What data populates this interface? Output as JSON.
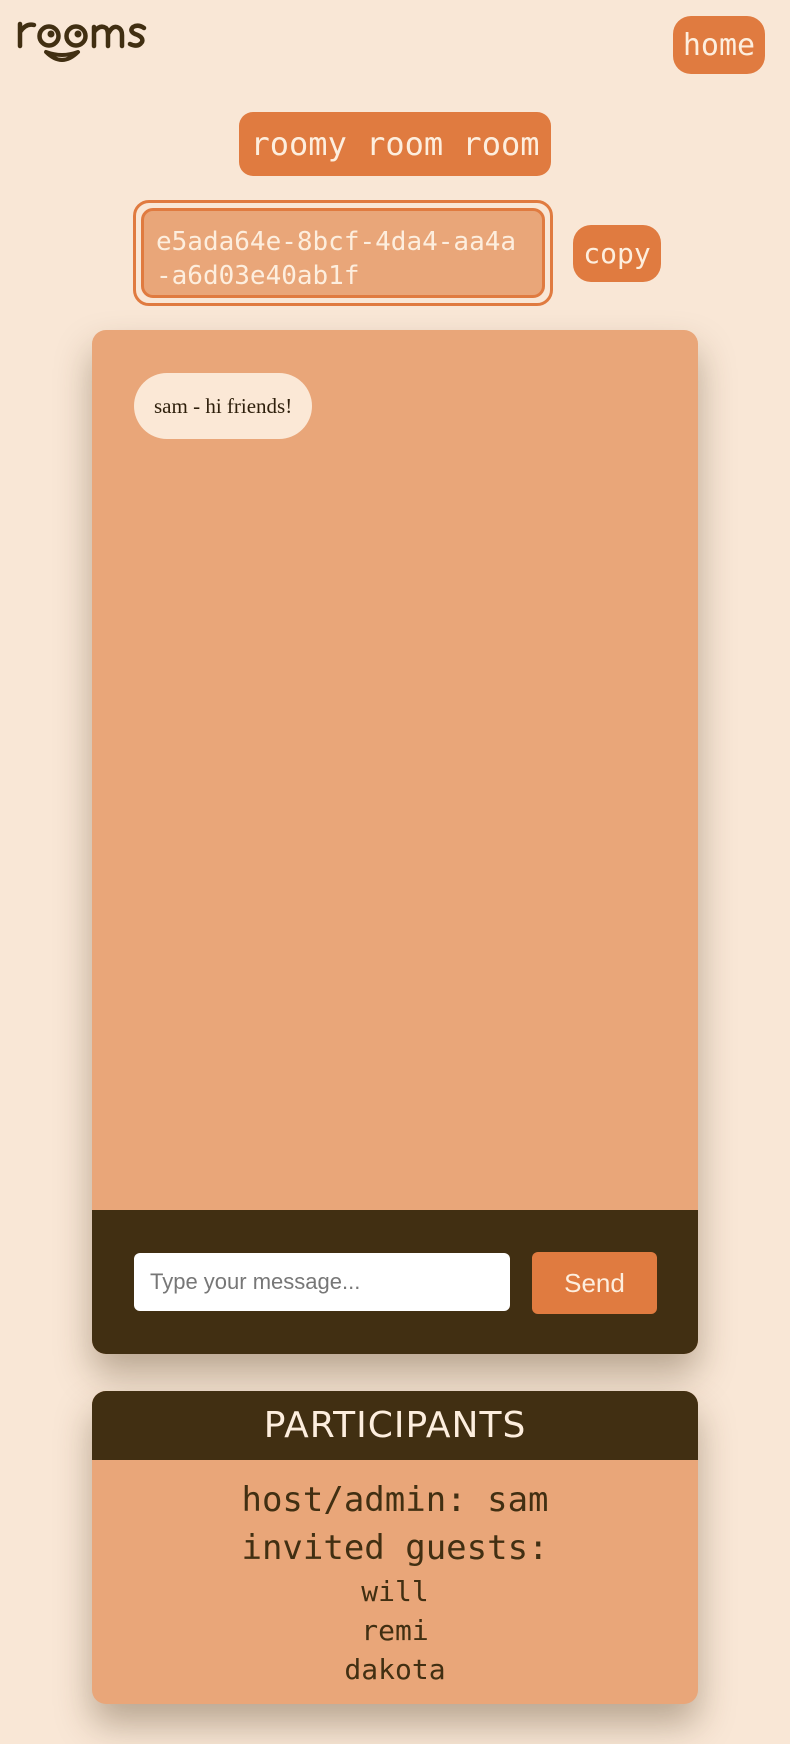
{
  "header": {
    "logo_text": "rooms",
    "home_label": "home"
  },
  "room": {
    "title": "roomy room room",
    "code": "e5ada64e-8bcf-4da4-aa4a-a6d03e40ab1f",
    "copy_label": "copy"
  },
  "chat": {
    "messages": [
      {
        "text": "sam - hi friends!"
      }
    ],
    "input_placeholder": "Type your message...",
    "send_label": "Send"
  },
  "participants": {
    "heading": "PARTICIPANTS",
    "host_line": "host/admin: sam",
    "guests_label": "invited guests:",
    "guests": [
      "will",
      "remi",
      "dakota"
    ]
  },
  "colors": {
    "background": "#f9e7d6",
    "accent": "#e07b40",
    "panel": "#e9a679",
    "dark": "#412f12",
    "light_text": "#fdeede"
  }
}
